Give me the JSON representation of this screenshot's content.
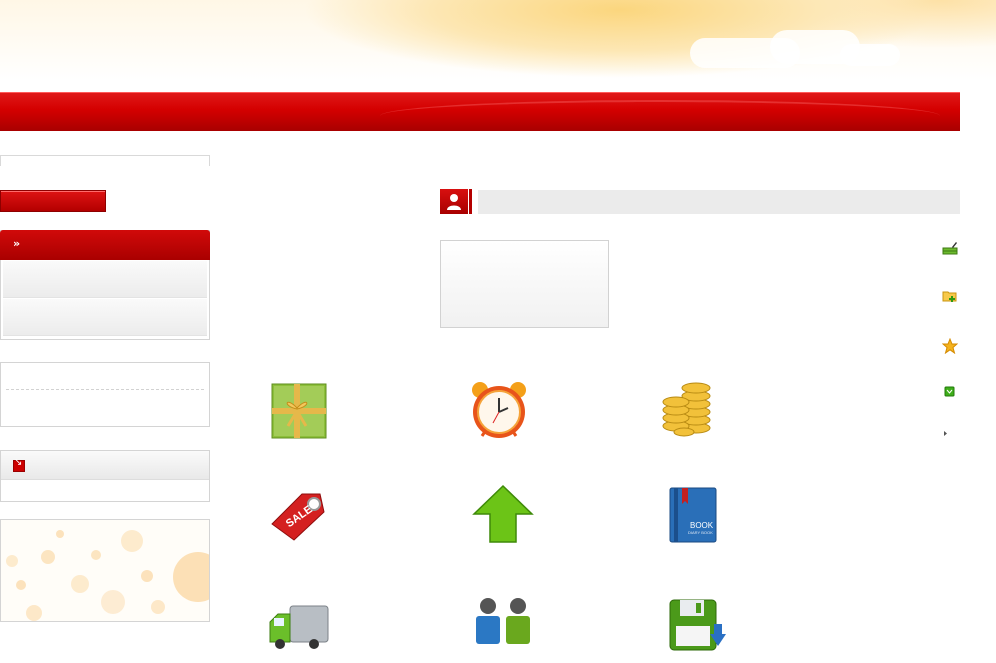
{
  "header": {},
  "icons": {
    "menu_head": "double-chevron-icon",
    "user_section": "user-icon",
    "notice": "arrow-down-right-icon",
    "tiles": [
      "gift-icon",
      "alarm-clock-icon",
      "coins-icon",
      "sale-tag-icon",
      "upload-arrow-icon",
      "book-icon",
      "truck-icon",
      "users-icon",
      "save-icon"
    ],
    "side": [
      "basket-edit-icon",
      "folder-add-icon",
      "star-icon",
      "shield-icon",
      "bullet-arrow-icon"
    ]
  },
  "colors": {
    "brand_red": "#c80000",
    "panel_border": "#d4d4d4",
    "section_bar": "#ebebeb"
  },
  "tiles": [
    {
      "label": ""
    },
    {
      "label": ""
    },
    {
      "label": ""
    },
    {
      "label": ""
    },
    {
      "label": ""
    },
    {
      "label": ""
    },
    {
      "label": ""
    },
    {
      "label": ""
    },
    {
      "label": ""
    }
  ],
  "menu": {
    "head_label": "»"
  }
}
